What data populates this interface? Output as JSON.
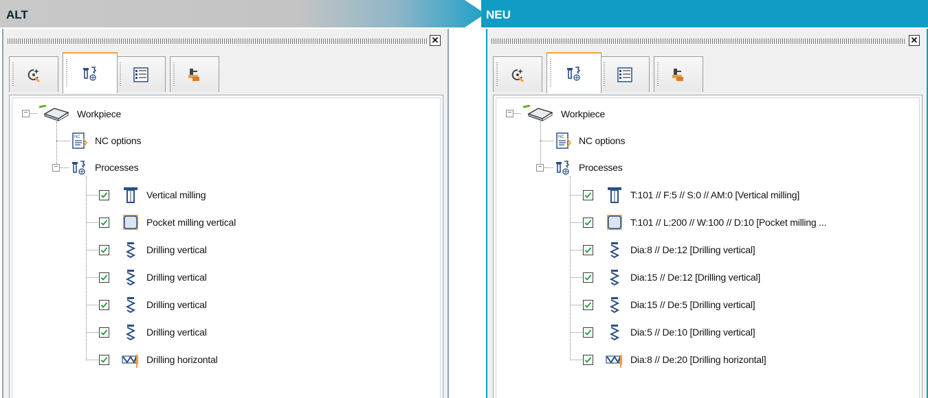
{
  "alt": {
    "banner": "ALT",
    "tree": {
      "root": "Workpiece",
      "nc_options": "NC options",
      "processes": "Processes",
      "items": [
        {
          "icon": "vertical-milling-icon",
          "label": "Vertical milling",
          "checked": true
        },
        {
          "icon": "pocket-milling-icon",
          "label": "Pocket milling vertical",
          "checked": true
        },
        {
          "icon": "drill-vertical-icon",
          "label": "Drilling vertical",
          "checked": true
        },
        {
          "icon": "drill-vertical-icon",
          "label": "Drilling vertical",
          "checked": true
        },
        {
          "icon": "drill-vertical-icon",
          "label": "Drilling vertical",
          "checked": true
        },
        {
          "icon": "drill-vertical-icon",
          "label": "Drilling vertical",
          "checked": true
        },
        {
          "icon": "drill-horizontal-icon",
          "label": "Drilling horizontal",
          "checked": true
        }
      ]
    }
  },
  "neu": {
    "banner": "NEU",
    "tree": {
      "root": "Workpiece",
      "nc_options": "NC options",
      "processes": "Processes",
      "items": [
        {
          "icon": "vertical-milling-icon",
          "label": "T:101 // F:5 // S:0 // AM:0  [Vertical milling]",
          "checked": true
        },
        {
          "icon": "pocket-milling-icon",
          "label": "T:101 // L:200 // W:100 // D:10  [Pocket milling ...",
          "checked": true
        },
        {
          "icon": "drill-vertical-icon",
          "label": "Dia:8 // De:12  [Drilling vertical]",
          "checked": true
        },
        {
          "icon": "drill-vertical-icon",
          "label": "Dia:15 // De:12  [Drilling vertical]",
          "checked": true
        },
        {
          "icon": "drill-vertical-icon",
          "label": "Dia:15 // De:5  [Drilling vertical]",
          "checked": true
        },
        {
          "icon": "drill-vertical-icon",
          "label": "Dia:5 // De:10  [Drilling vertical]",
          "checked": true
        },
        {
          "icon": "drill-horizontal-icon",
          "label": "Dia:8 // De:20  [Drilling horizontal]",
          "checked": true
        }
      ]
    }
  },
  "tabs": [
    {
      "icon": "contour-icon"
    },
    {
      "icon": "processes-icon",
      "active": true
    },
    {
      "icon": "list-icon"
    },
    {
      "icon": "machine-icon"
    }
  ],
  "close_glyph": "✕",
  "colors": {
    "accent": "#109cc5",
    "tab_active": "#f2a23a",
    "check": "#1e9a3c"
  }
}
